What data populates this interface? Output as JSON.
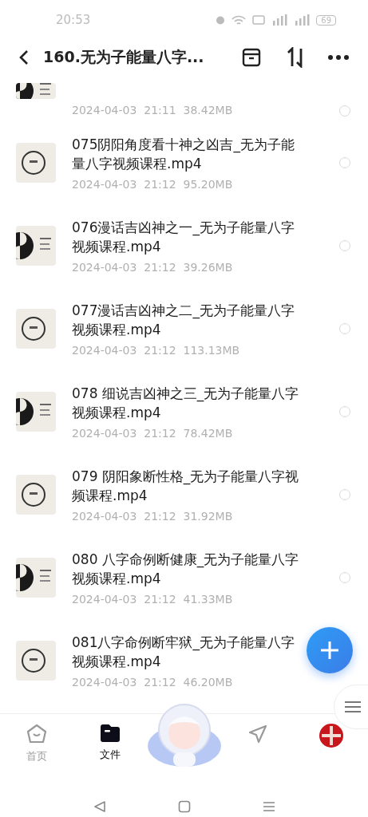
{
  "status_bar": {
    "time": "20:53",
    "battery": "69"
  },
  "header": {
    "title": "160.无为子能量八字..."
  },
  "files": [
    {
      "kind": "partial",
      "date": "2024-04-03",
      "time": "21:11",
      "size": "38.42MB",
      "selected": false
    },
    {
      "kind": "full",
      "title": "075阴阳角度看十神之凶吉_无为子能量八字视频课程.mp4",
      "date": "2024-04-03",
      "time": "21:12",
      "size": "95.20MB",
      "selected": false
    },
    {
      "kind": "full",
      "title": "076漫话吉凶神之一_无为子能量八字视频课程.mp4",
      "date": "2024-04-03",
      "time": "21:12",
      "size": "39.26MB",
      "selected": false
    },
    {
      "kind": "full",
      "title": "077漫话吉凶神之二_无为子能量八字视频课程.mp4",
      "date": "2024-04-03",
      "time": "21:12",
      "size": "113.13MB",
      "selected": false
    },
    {
      "kind": "full",
      "title": "078 细说吉凶神之三_无为子能量八字视频课程.mp4",
      "date": "2024-04-03",
      "time": "21:12",
      "size": "78.42MB",
      "selected": false
    },
    {
      "kind": "full",
      "title": "079 阴阳象断性格_无为子能量八字视频课程.mp4",
      "date": "2024-04-03",
      "time": "21:12",
      "size": "31.92MB",
      "selected": false
    },
    {
      "kind": "full",
      "title": "080 八字命例断健康_无为子能量八字视频课程.mp4",
      "date": "2024-04-03",
      "time": "21:12",
      "size": "41.33MB",
      "selected": false
    },
    {
      "kind": "full",
      "title": "081八字命例断牢狱_无为子能量八字视频课程.mp4",
      "date": "2024-04-03",
      "time": "21:12",
      "size": "46.20MB",
      "selected": false
    }
  ],
  "bottom_nav": [
    {
      "kind": "home",
      "label": "首页",
      "selected": false
    },
    {
      "kind": "files",
      "label": "文件",
      "selected": true
    },
    {
      "kind": "mascot"
    },
    {
      "kind": "share"
    },
    {
      "kind": "avatar"
    }
  ]
}
